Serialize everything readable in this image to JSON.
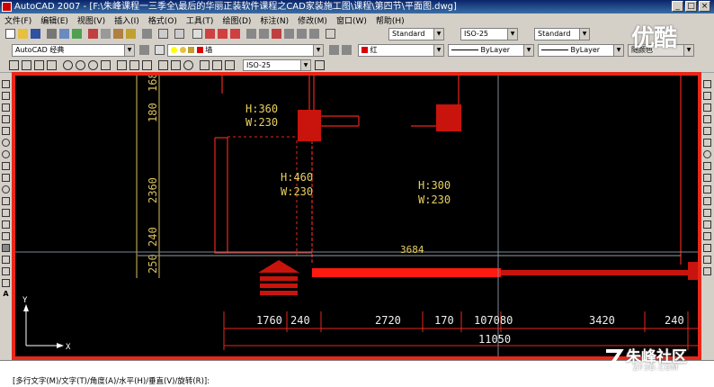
{
  "window": {
    "title": "AutoCAD 2007 - [F:\\朱峰课程一三季全\\最后的华丽正装软件课程之CAD家装施工图\\课程\\第四节\\平面图.dwg]"
  },
  "menu": [
    "文件(F)",
    "编辑(E)",
    "视图(V)",
    "插入(I)",
    "格式(O)",
    "工具(T)",
    "绘图(D)",
    "标注(N)",
    "修改(M)",
    "窗口(W)",
    "帮助(H)"
  ],
  "toolbar": {
    "text_style": "Standard",
    "dim_style": "ISO-25",
    "table_style": "Standard",
    "workspace": "AutoCAD 经典",
    "layer": "墙",
    "color": "红",
    "linetype": "ByLayer",
    "lineweight": "ByLayer",
    "plotstyle": "随颜色",
    "dim_style_2": "ISO-25"
  },
  "drawing": {
    "labels": {
      "h360": "H:360",
      "w230a": "W:230",
      "h460": "H:460",
      "w230b": "W:230",
      "h300": "H:300",
      "w230c": "W:230",
      "dim_3684": "3684"
    },
    "vdims": {
      "d168": "168",
      "d180": "180",
      "d2360": "2360",
      "d240": "240",
      "d250": "250"
    },
    "hdims": {
      "d1760": "1760",
      "d240a": "240",
      "d2720": "2720",
      "d170": "170",
      "d107080": "107080",
      "d3420": "3420",
      "d240b": "240",
      "d11050": "11050"
    },
    "ucs": {
      "x": "X",
      "y": "Y"
    }
  },
  "command": {
    "prompt": "[多行文字(M)/文字(T)/角度(A)/水平(H)/垂直(V)/旋转(R)]:"
  },
  "watermarks": {
    "youku": "优酷",
    "zhufeng": "朱峰社区",
    "zhufeng_url": "ZF3D.COM"
  }
}
